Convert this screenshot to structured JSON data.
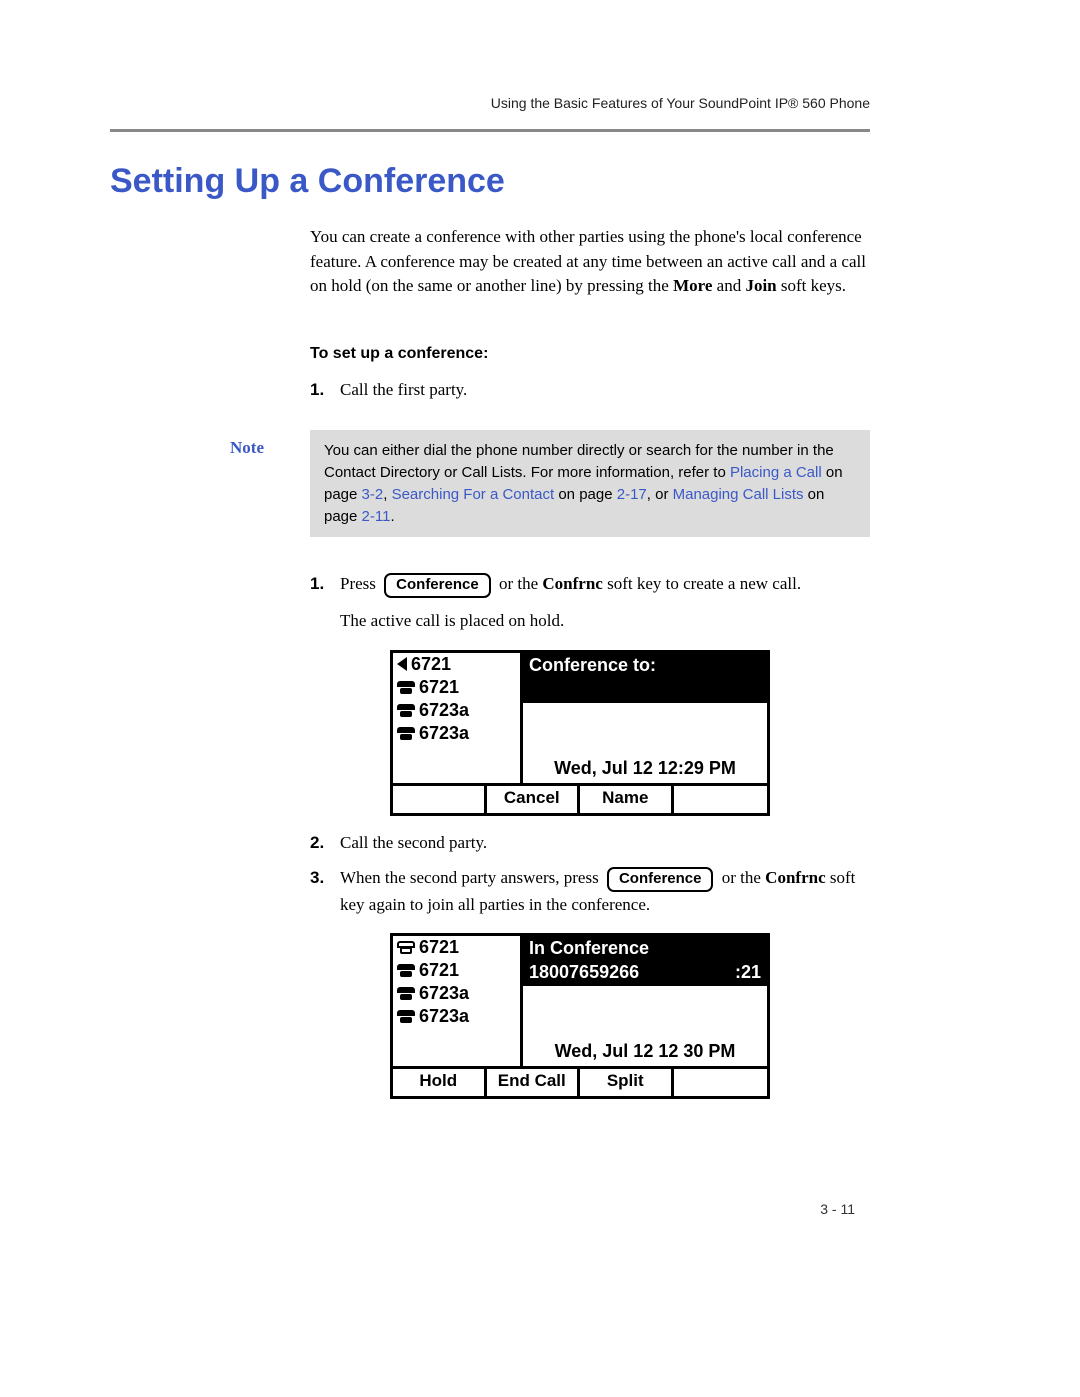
{
  "header": {
    "running_head": "Using the Basic Features of Your SoundPoint IP® 560 Phone"
  },
  "title": "Setting Up a Conference",
  "intro": {
    "part1": "You can create a conference with other parties using the phone's local conference feature. A conference may be created at any time between an active call and a call on hold (on the same or another line) by pressing the ",
    "more": "More",
    "and": " and ",
    "join": "Join",
    "part2": " soft keys."
  },
  "subhead": "To set up a conference:",
  "step1": {
    "num": "1.",
    "text": "Call the first party."
  },
  "note": {
    "label": "Note",
    "body_part1": "You can either dial the phone number directly or search for the number in the Contact Directory or Call Lists. For more information, refer to ",
    "link1": "Placing a Call",
    "mid1": " on page ",
    "page1": "3-2",
    "mid2": ", ",
    "link2": "Searching For a Contact",
    "mid3": " on page ",
    "page2": "2-17",
    "mid4": ", or ",
    "link3": "Managing Call Lists",
    "mid5": " on page ",
    "page3": "2-11",
    "end": "."
  },
  "step1b": {
    "num": "1.",
    "t1": "Press ",
    "button": "Conference",
    "t2": " or the ",
    "bold": "Confrnc",
    "t3": " soft key to create a new call."
  },
  "followup1": "The active call is placed on hold.",
  "screen1": {
    "lines": [
      "6721",
      "6721",
      "6723a",
      "6723a"
    ],
    "title": "Conference to:",
    "edit_left": "",
    "edit_right": "",
    "time": "Wed, Jul 12  12:29 PM",
    "sk": [
      "",
      "Cancel",
      "Name",
      ""
    ]
  },
  "step2": {
    "num": "2.",
    "text": "Call the second party."
  },
  "step3": {
    "num": "3.",
    "t1": "When the second party answers, press ",
    "button": "Conference",
    "t2": " or the ",
    "bold": "Confrnc",
    "t3": " soft key again to join all parties in the conference."
  },
  "screen2": {
    "lines": [
      "6721",
      "6721",
      "6723a",
      "6723a"
    ],
    "title": "In Conference",
    "edit_left": "18007659266",
    "edit_right": ":21",
    "time": "Wed, Jul 12  12 30 PM",
    "sk": [
      "Hold",
      "End Call",
      "Split",
      ""
    ]
  },
  "page_num": "3 - 11"
}
